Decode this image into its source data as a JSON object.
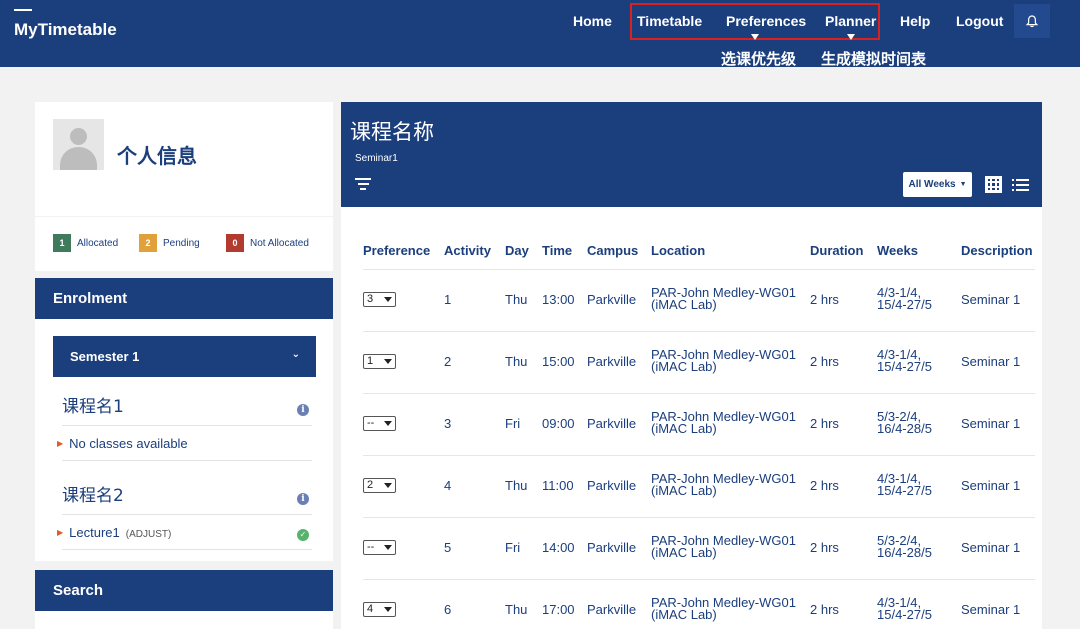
{
  "header": {
    "brand": "MyTimetable",
    "nav": [
      "Home",
      "Timetable",
      "Preferences",
      "Planner",
      "Help",
      "Logout"
    ],
    "annotations": [
      "选课优先级",
      "生成模拟时间表"
    ]
  },
  "profile": {
    "name": "个人信息",
    "legend": [
      {
        "count": "1",
        "label": "Allocated",
        "color": "#3f7a5c"
      },
      {
        "count": "2",
        "label": "Pending",
        "color": "#e0a13a"
      },
      {
        "count": "0",
        "label": "Not Allocated",
        "color": "#b23a2e"
      }
    ]
  },
  "enrolment": {
    "title": "Enrolment",
    "semester": "Semester 1",
    "courses": [
      {
        "name": "课程名1",
        "line": "No classes available",
        "tag": ""
      },
      {
        "name": "课程名2",
        "line": "Lecture1",
        "tag": "(ADJUST)"
      }
    ]
  },
  "search": {
    "title": "Search"
  },
  "main": {
    "title": "课程名称",
    "subtitle": "Seminar1",
    "weeks_filter": "All Weeks",
    "columns": [
      "Preference",
      "Activity",
      "Day",
      "Time",
      "Campus",
      "Location",
      "Duration",
      "Weeks",
      "Description"
    ],
    "rows": [
      {
        "pref": "3",
        "activity": "1",
        "day": "Thu",
        "time": "13:00",
        "campus": "Parkville",
        "loc1": "PAR-John Medley-WG01",
        "loc2": "(iMAC Lab)",
        "duration": "2 hrs",
        "weeks1": "4/3-1/4,",
        "weeks2": "15/4-27/5",
        "desc": "Seminar 1"
      },
      {
        "pref": "1",
        "activity": "2",
        "day": "Thu",
        "time": "15:00",
        "campus": "Parkville",
        "loc1": "PAR-John Medley-WG01",
        "loc2": "(iMAC Lab)",
        "duration": "2 hrs",
        "weeks1": "4/3-1/4,",
        "weeks2": "15/4-27/5",
        "desc": "Seminar 1"
      },
      {
        "pref": "--",
        "activity": "3",
        "day": "Fri",
        "time": "09:00",
        "campus": "Parkville",
        "loc1": "PAR-John Medley-WG01",
        "loc2": "(iMAC Lab)",
        "duration": "2 hrs",
        "weeks1": "5/3-2/4,",
        "weeks2": "16/4-28/5",
        "desc": "Seminar 1"
      },
      {
        "pref": "2",
        "activity": "4",
        "day": "Thu",
        "time": "11:00",
        "campus": "Parkville",
        "loc1": "PAR-John Medley-WG01",
        "loc2": "(iMAC Lab)",
        "duration": "2 hrs",
        "weeks1": "4/3-1/4,",
        "weeks2": "15/4-27/5",
        "desc": "Seminar 1"
      },
      {
        "pref": "--",
        "activity": "5",
        "day": "Fri",
        "time": "14:00",
        "campus": "Parkville",
        "loc1": "PAR-John Medley-WG01",
        "loc2": "(iMAC Lab)",
        "duration": "2 hrs",
        "weeks1": "5/3-2/4,",
        "weeks2": "16/4-28/5",
        "desc": "Seminar 1"
      },
      {
        "pref": "4",
        "activity": "6",
        "day": "Thu",
        "time": "17:00",
        "campus": "Parkville",
        "loc1": "PAR-John Medley-WG01",
        "loc2": "(iMAC Lab)",
        "duration": "2 hrs",
        "weeks1": "4/3-1/4,",
        "weeks2": "15/4-27/5",
        "desc": "Seminar 1"
      }
    ]
  },
  "icons": {
    "bell": "bell-icon",
    "filter": "filter-icon",
    "grid": "grid-view-icon",
    "list": "list-view-icon"
  }
}
